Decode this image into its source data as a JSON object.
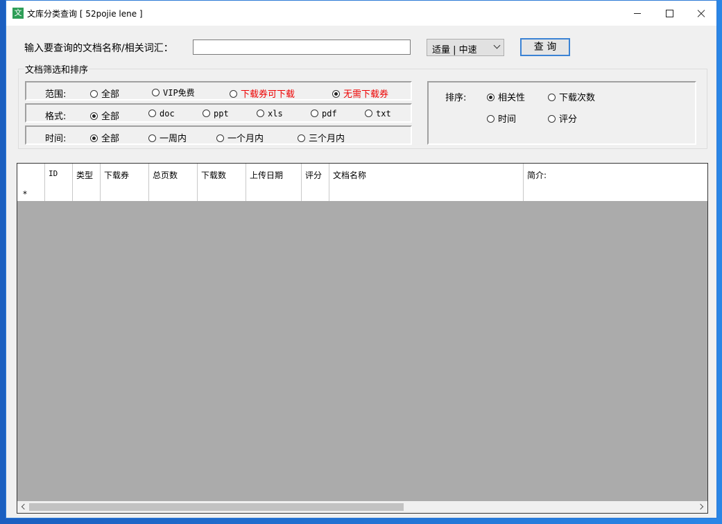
{
  "window": {
    "title": "文库分类查询 [ 52pojie lene ]",
    "icon_char": "文"
  },
  "search": {
    "label": "输入要查询的文档名称/相关词汇：",
    "value": "",
    "mode_selected": "适量 | 中速",
    "query_button": "查 询"
  },
  "filters": {
    "group_title": "文档筛选和排序",
    "scope": {
      "label": "范围:",
      "options": [
        "全部",
        "VIP免费",
        "下载券可下载",
        "无需下载券"
      ],
      "selected": 3
    },
    "format": {
      "label": "格式:",
      "options": [
        "全部",
        "doc",
        "ppt",
        "xls",
        "pdf",
        "txt"
      ],
      "selected": 0
    },
    "time": {
      "label": "时间:",
      "options": [
        "全部",
        "一周内",
        "一个月内",
        "三个月内"
      ],
      "selected": 0
    }
  },
  "sort": {
    "label": "排序:",
    "options": [
      "相关性",
      "下载次数",
      "时间",
      "评分"
    ],
    "selected": 0
  },
  "grid": {
    "columns": [
      "ID",
      "类型",
      "下载券",
      "总页数",
      "下载数",
      "上传日期",
      "评分",
      "文档名称",
      "简介:"
    ],
    "new_row_marker": "*"
  }
}
